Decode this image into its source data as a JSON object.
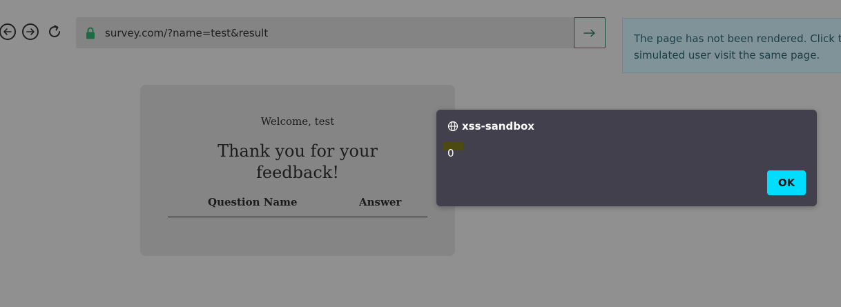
{
  "browser": {
    "back_icon": "arrow-left-icon",
    "forward_icon": "arrow-right-icon",
    "reload_icon": "reload-icon",
    "url": "survey.com/?name=test&result",
    "go_icon": "arrow-right-icon",
    "lock_color": "#1d6b44"
  },
  "info_box": {
    "text_line1": "The page has not been rendered. Click the",
    "text_line2": "simulated user visit the same page."
  },
  "card": {
    "welcome": "Welcome, test",
    "title_line1": "Thank you for your",
    "title_line2": "feedback!",
    "table_headers": [
      "Question Name",
      "Answer"
    ]
  },
  "dialog": {
    "origin_icon": "globe-icon",
    "origin": "xss-sandbox",
    "message": "0",
    "ok_label": "OK",
    "ok_color": "#00ddff"
  }
}
